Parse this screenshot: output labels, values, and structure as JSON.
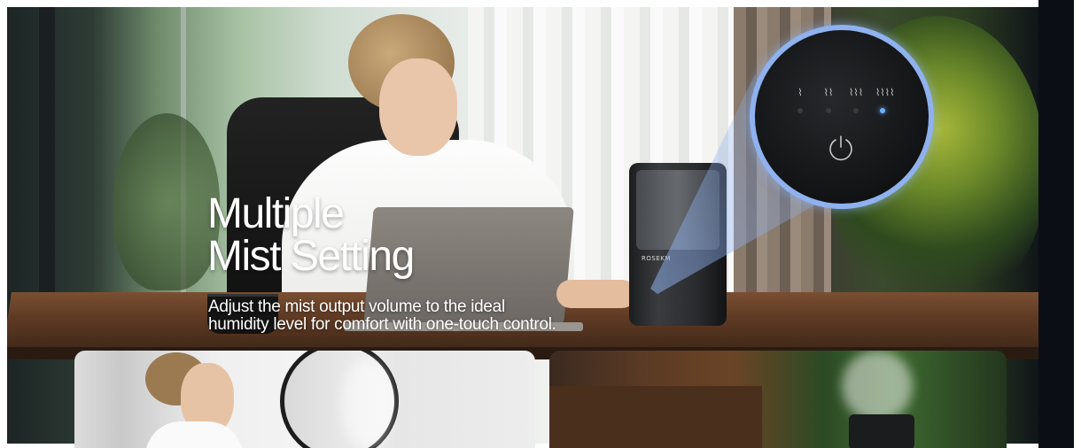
{
  "headline": {
    "line1": "Multiple",
    "line2": "Mist Setting"
  },
  "description": {
    "line1": "Adjust the mist output volume to the ideal",
    "line2": "humidity level for comfort with one-touch control."
  },
  "device": {
    "brand": "ROSEKM",
    "mist_levels": 4,
    "active_level": 4,
    "indicator_color": "#6ab4ff",
    "zoom_ring_color": "#8fb1ee"
  },
  "icons": {
    "power": "power-icon",
    "mist_level": "mist-level-icon"
  },
  "colors": {
    "headline_text": "#ffffff",
    "device_body": "#1c1d1f"
  }
}
